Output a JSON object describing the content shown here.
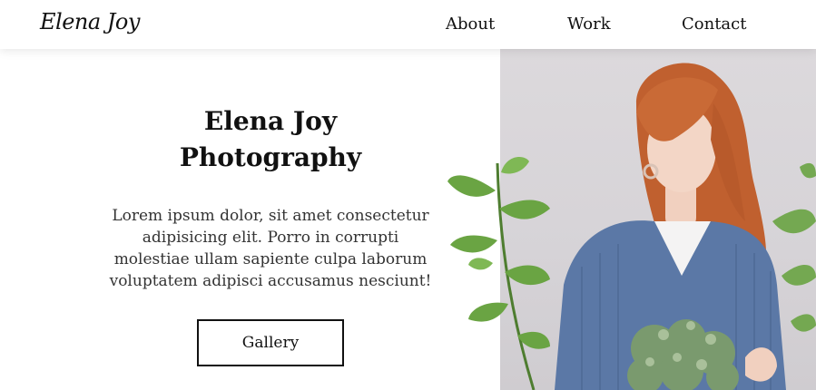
{
  "header": {
    "logo_text": "Elena Joy",
    "nav": [
      {
        "label": "About"
      },
      {
        "label": "Work"
      },
      {
        "label": "Contact"
      }
    ]
  },
  "hero": {
    "title_line1": "Elena Joy",
    "title_line2": "Photography",
    "description": "Lorem ipsum dolor, sit amet consectetur adipisicing elit. Porro in corrupti molestiae ullam sapiente culpa laborum voluptatem adipisci accusamus nesciunt!",
    "button_label": "Gallery"
  },
  "colors": {
    "background": "#ffffff",
    "text": "#111111",
    "photo_bg": "#d9d6da",
    "sweater_blue": "#5b78a6",
    "hair": "#c56a3a",
    "leaf_green": "#5f9a3e"
  }
}
